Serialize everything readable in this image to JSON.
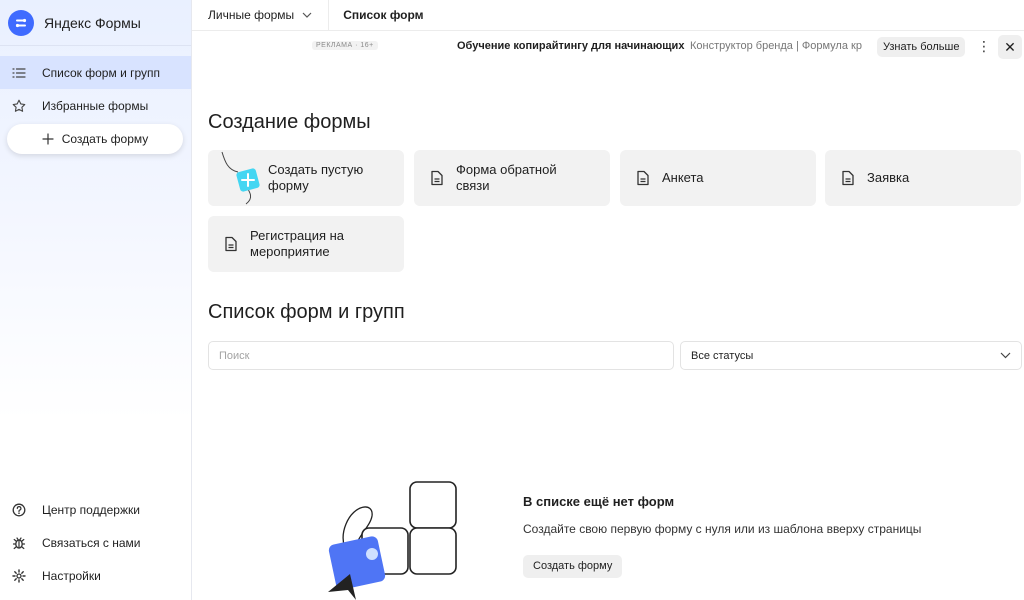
{
  "sidebar": {
    "brand": "Яндекс Формы",
    "items": [
      {
        "label": "Список форм и групп",
        "icon": "list-icon"
      },
      {
        "label": "Избранные формы",
        "icon": "star-icon"
      }
    ],
    "create_label": "Создать форму",
    "bottom": [
      {
        "label": "Центр поддержки",
        "icon": "help-icon"
      },
      {
        "label": "Связаться с нами",
        "icon": "bug-icon"
      },
      {
        "label": "Настройки",
        "icon": "gear-icon"
      }
    ]
  },
  "topbar": {
    "scope": "Личные формы",
    "page": "Список форм"
  },
  "ad": {
    "label": "РЕКЛАМА · 16+",
    "title": "Обучение копирайтингу для начинающих",
    "links": "Конструктор бренда | Формула кр",
    "more": "Узнать больше"
  },
  "create_section": {
    "title": "Создание формы",
    "cards": [
      {
        "label": "Создать пустую форму"
      },
      {
        "label": "Форма обратной связи"
      },
      {
        "label": "Анкета"
      },
      {
        "label": "Заявка"
      },
      {
        "label": "Регистрация на мероприятие"
      }
    ]
  },
  "list_section": {
    "title": "Список форм и групп",
    "search_placeholder": "Поиск",
    "status_value": "Все статусы"
  },
  "empty": {
    "title": "В списке ещё нет форм",
    "text": "Создайте свою первую форму с нуля или из шаблона вверху страницы",
    "button": "Создать форму"
  },
  "colors": {
    "accent": "#3f6bff",
    "active_nav": "#d8e3ff",
    "card_bg": "#f2f2f2"
  }
}
